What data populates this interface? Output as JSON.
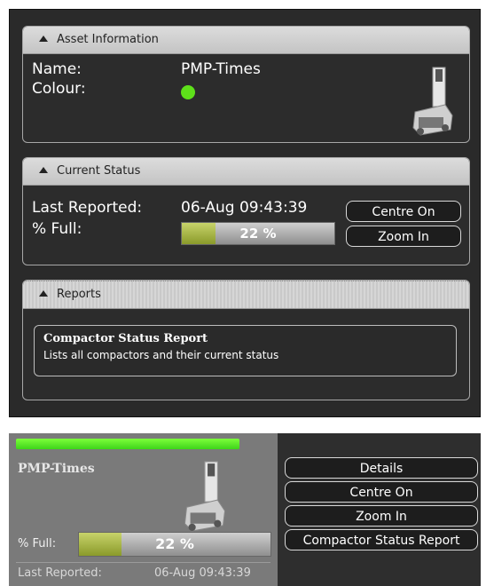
{
  "asset_info": {
    "header": "Asset Information",
    "name_label": "Name:",
    "name_value": "PMP-Times",
    "colour_label": "Colour:",
    "colour_value": "#5ee01a"
  },
  "current_status": {
    "header": "Current Status",
    "last_reported_label": "Last Reported:",
    "last_reported_value": "06-Aug 09:43:39",
    "percent_full_label": "% Full:",
    "percent_full_text": "22 %",
    "percent_full": 22,
    "centre_on_label": "Centre On",
    "zoom_in_label": "Zoom In"
  },
  "reports": {
    "header": "Reports",
    "items": [
      {
        "title": "Compactor Status Report",
        "description": "Lists all compactors and their current status"
      }
    ]
  },
  "mini_panel": {
    "name": "PMP-Times",
    "percent_full_label": "% Full:",
    "percent_full_text": "22 %",
    "percent_full": 22,
    "last_reported_label": "Last Reported:",
    "last_reported_value": "06-Aug 09:43:39",
    "buttons": {
      "details": "Details",
      "centre_on": "Centre On",
      "zoom_in": "Zoom In",
      "report": "Compactor Status Report"
    },
    "status_color": "#4fe026"
  }
}
